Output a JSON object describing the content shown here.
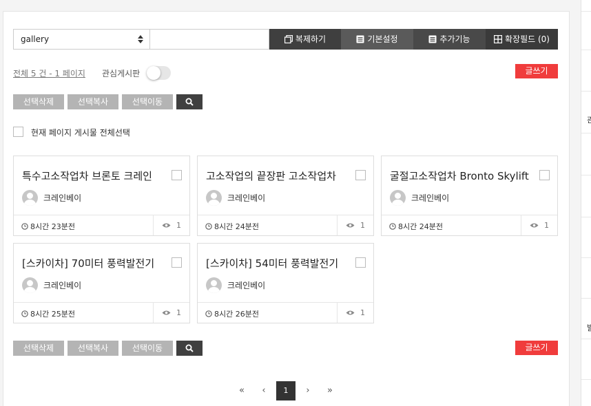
{
  "toolbar": {
    "board_select": "gallery",
    "search_value": "",
    "copy_label": "복제하기",
    "basic_settings_label": "기본설정",
    "extra_features_label": "추가기능",
    "extension_fields_label": "확장필드 (0)",
    "colors": {
      "copy": "#3f3f3f",
      "basic": "#5a5a5a",
      "extra": "#494949",
      "ext": "#3a3a3a"
    }
  },
  "list_info": {
    "total_text": "전체 5 건 - 1 페이지",
    "favorite_label": "관심게시판",
    "favorite_on": false,
    "write_label": "글쓰기"
  },
  "actions": {
    "delete_label": "선택삭제",
    "copy_label": "선택복사",
    "move_label": "선택이동"
  },
  "select_all_label": "현재 페이지 게시물 전체선택",
  "posts": [
    {
      "title": "특수고소작업차 브론토 크레인",
      "author": "크레인베이",
      "time": "8시간 23분전",
      "views": "1"
    },
    {
      "title": "고소작업의 끝장판 고소작업차",
      "author": "크레인베이",
      "time": "8시간 24분전",
      "views": "1"
    },
    {
      "title": "굴절고소작업차 Bronto Skylift",
      "author": "크레인베이",
      "time": "8시간 24분전",
      "views": "1"
    },
    {
      "title": "[스카이차] 70미터 풍력발전기",
      "author": "크레인베이",
      "time": "8시간 25분전",
      "views": "1"
    },
    {
      "title": "[스카이차] 54미터 풍력발전기",
      "author": "크레인베이",
      "time": "8시간 26분전",
      "views": "1"
    }
  ],
  "pagination": {
    "first": "«",
    "prev": "‹",
    "current": "1",
    "next": "›",
    "last": "»"
  },
  "right_sidebar": {
    "fragments": [
      "관",
      "발"
    ]
  }
}
